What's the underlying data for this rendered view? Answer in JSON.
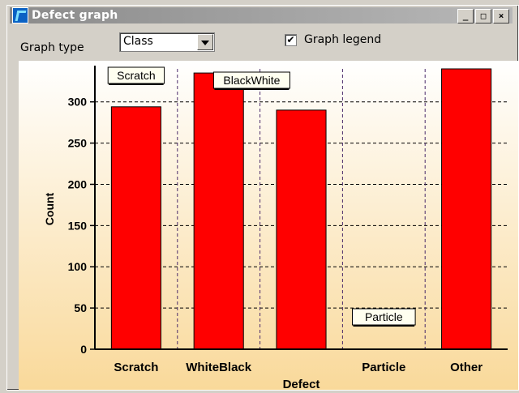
{
  "window": {
    "title": "Defect graph",
    "buttons": [
      "_",
      "□",
      "×"
    ]
  },
  "toolbar": {
    "graph_type_label": "Graph type",
    "graph_type_value": "Class",
    "legend_label": "Graph legend",
    "legend_checked": true
  },
  "chart_data": {
    "type": "bar",
    "categories": [
      "Scratch",
      "WhiteBlack",
      "",
      "Particle",
      "Other"
    ],
    "values": [
      294,
      335,
      290,
      0,
      340
    ],
    "xlabel": "Defect",
    "ylabel": "Count",
    "ylim": [
      0,
      340
    ],
    "yticks": [
      0,
      50,
      100,
      150,
      200,
      250,
      300
    ],
    "grid": true,
    "bar_color": "#ff0000",
    "annotations": [
      {
        "text": "Scratch",
        "category": "Scratch"
      },
      {
        "text": "BlackWhite",
        "category": ""
      },
      {
        "text": "Particle",
        "category": "Particle"
      }
    ]
  },
  "colors": {
    "bg_top": "#ffffff",
    "bg_bottom": "#f9d99a"
  }
}
